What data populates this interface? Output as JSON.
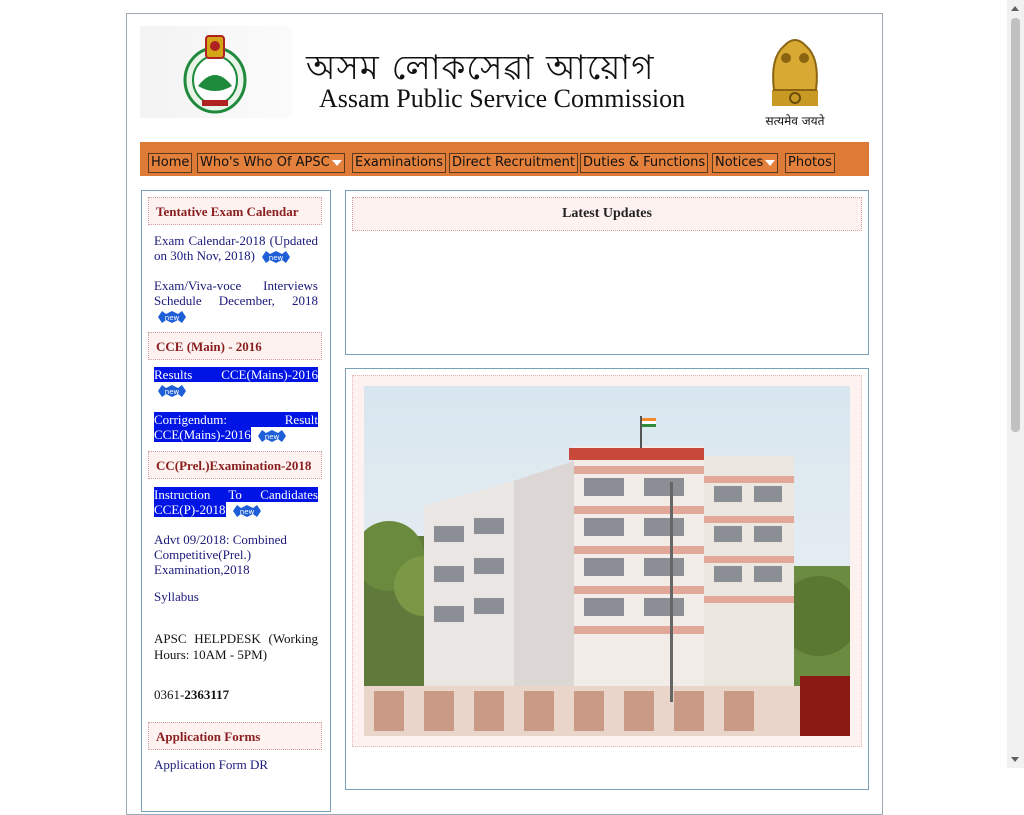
{
  "header": {
    "title_bn": "অসম লোকসেৱা আয়োগ",
    "title_en": "Assam Public Service Commission",
    "motto": "सत्यमेव जयते",
    "emblem_left_icon": "assam-logo-icon",
    "emblem_right_icon": "ashoka-emblem-icon"
  },
  "nav": {
    "home": "Home",
    "whos_who": "Who's Who Of APSC",
    "examinations": "Examinations",
    "direct_recruitment": "Direct Recruitment",
    "duties": "Duties & Functions",
    "notices": "Notices",
    "photos": "Photos"
  },
  "sidebar": {
    "sec1": "Tentative Exam Calendar",
    "link_exam_calendar": "Exam Calendar-2018 (Updated on 30th Nov, 2018)",
    "link_viva": "Exam/Viva-voce Interviews Schedule December, 2018",
    "sec2": "CCE (Main) - 2016",
    "link_results": "Results CCE(Mains)-2016",
    "link_corrigendum": "Corrigendum: Result CCE(Mains)-2016",
    "sec3": "CC(Prel.)Examination-2018",
    "link_instruction": "Instruction To Candidates CCE(P)-2018",
    "link_advt": "Advt 09/2018: Combined Competitive(Prel.) Examination,2018",
    "link_syllabus": "Syllabus",
    "helpdesk": "APSC HELPDESK (Working Hours: 10AM - 5PM)",
    "phone_prefix": "0361-",
    "phone_number": "2363117",
    "sec4": "Application Forms",
    "link_app_form": "Application Form DR",
    "new_badge": "new"
  },
  "main": {
    "updates_title": "Latest Updates"
  },
  "colors": {
    "nav_bg": "#dd7a36",
    "heading_red": "#8a1e1e",
    "link_blue": "#1a1a7a",
    "highlight": "#0014e6"
  }
}
